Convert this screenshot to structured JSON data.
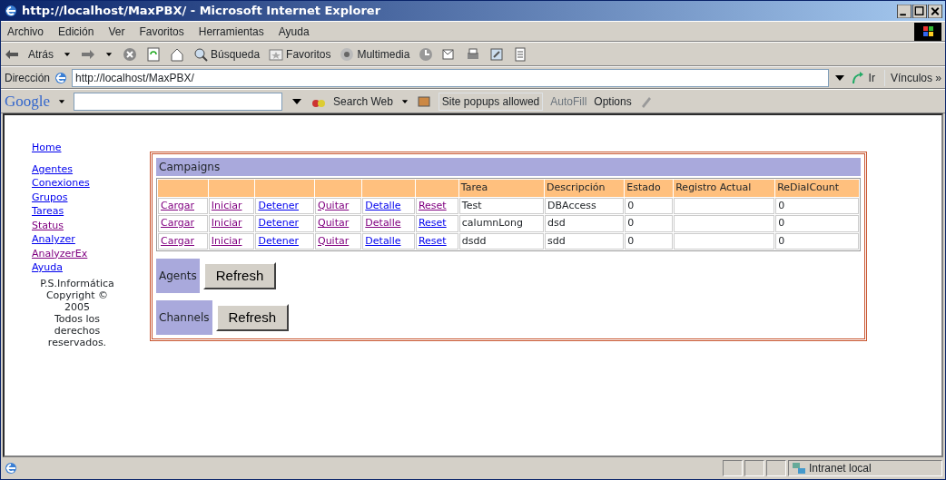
{
  "window": {
    "title": "http://localhost/MaxPBX/ - Microsoft Internet Explorer"
  },
  "menu": [
    "Archivo",
    "Edición",
    "Ver",
    "Favoritos",
    "Herramientas",
    "Ayuda"
  ],
  "toolbar": {
    "back": "Atrás",
    "search": "Búsqueda",
    "favorites": "Favoritos",
    "media": "Multimedia"
  },
  "address_bar": {
    "label": "Dirección",
    "value": "http://localhost/MaxPBX/",
    "go": "Ir",
    "links": "Vínculos",
    "more": "»"
  },
  "google_bar": {
    "logo": "Google",
    "search_web": "Search Web",
    "popups": "Site popups allowed",
    "autofill": "AutoFill",
    "options": "Options"
  },
  "sidebar": {
    "items": [
      {
        "label": "Home",
        "visited": false
      },
      {
        "label": "Agentes",
        "visited": false
      },
      {
        "label": "Conexiones",
        "visited": false
      },
      {
        "label": "Grupos",
        "visited": false
      },
      {
        "label": "Tareas",
        "visited": false
      },
      {
        "label": "Status",
        "visited": true
      },
      {
        "label": "Analyzer",
        "visited": false
      },
      {
        "label": "AnalyzerEx",
        "visited": true
      },
      {
        "label": "Ayuda",
        "visited": false
      }
    ],
    "footer": [
      "P.S.Informática",
      "Copyright ©",
      "2005",
      "Todos los",
      "derechos",
      "reservados."
    ]
  },
  "campaigns": {
    "title": "Campaigns",
    "columns": [
      "Tarea",
      "Descripción",
      "Estado",
      "Registro Actual",
      "ReDialCount"
    ],
    "rows": [
      {
        "actions": [
          {
            "label": "Cargar",
            "visited": true
          },
          {
            "label": "Iniciar",
            "visited": true
          },
          {
            "label": "Detener",
            "visited": false
          },
          {
            "label": "Quitar",
            "visited": true
          },
          {
            "label": "Detalle",
            "visited": false
          },
          {
            "label": "Reset",
            "visited": true
          }
        ],
        "cells": [
          "Test",
          "DBAccess",
          "0",
          "",
          "0"
        ]
      },
      {
        "actions": [
          {
            "label": "Cargar",
            "visited": true
          },
          {
            "label": "Iniciar",
            "visited": true
          },
          {
            "label": "Detener",
            "visited": false
          },
          {
            "label": "Quitar",
            "visited": true
          },
          {
            "label": "Detalle",
            "visited": true
          },
          {
            "label": "Reset",
            "visited": false
          }
        ],
        "cells": [
          "calumnLong",
          "dsd",
          "0",
          "",
          "0"
        ]
      },
      {
        "actions": [
          {
            "label": "Cargar",
            "visited": true
          },
          {
            "label": "Iniciar",
            "visited": true
          },
          {
            "label": "Detener",
            "visited": false
          },
          {
            "label": "Quitar",
            "visited": true
          },
          {
            "label": "Detalle",
            "visited": false
          },
          {
            "label": "Reset",
            "visited": false
          }
        ],
        "cells": [
          "dsdd",
          "sdd",
          "0",
          "",
          "0"
        ]
      }
    ]
  },
  "sections": [
    {
      "label": "Agents",
      "button": "Refresh"
    },
    {
      "label": "Channels",
      "button": "Refresh"
    }
  ],
  "status_bar": {
    "zone": "Intranet local"
  }
}
